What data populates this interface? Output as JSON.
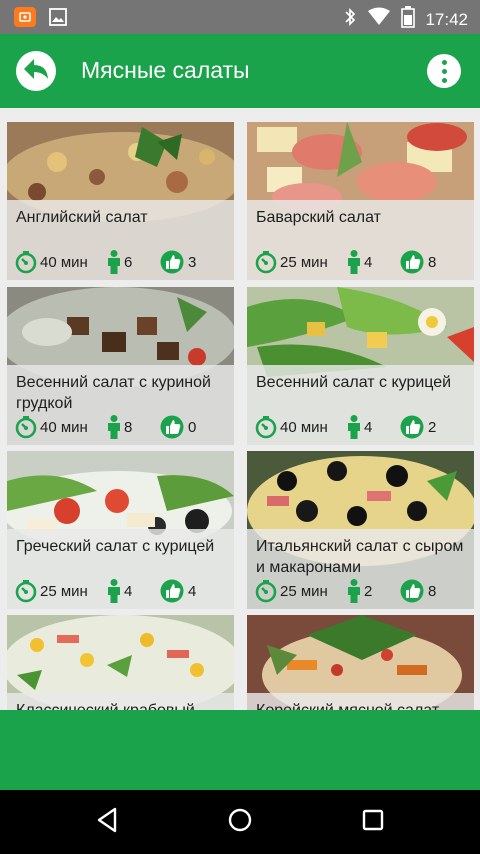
{
  "status_bar": {
    "time": "17:42"
  },
  "header": {
    "title": "Мясные салаты"
  },
  "colors": {
    "accent": "#1aa34a",
    "status_bar": "#757575",
    "nav_bar": "#000000"
  },
  "recipes": [
    {
      "name": "Английский салат",
      "time": "40 мин",
      "persons": "6",
      "likes": "3"
    },
    {
      "name": "Баварский салат",
      "time": "25 мин",
      "persons": "4",
      "likes": "8"
    },
    {
      "name": "Весенний салат с куриной грудкой",
      "time": "40 мин",
      "persons": "8",
      "likes": "0"
    },
    {
      "name": "Весенний салат с курицей",
      "time": "40 мин",
      "persons": "4",
      "likes": "2"
    },
    {
      "name": "Греческий салат с курицей",
      "time": "25 мин",
      "persons": "4",
      "likes": "4"
    },
    {
      "name": "Итальянский салат с сыром и макаронами",
      "time": "25 мин",
      "persons": "2",
      "likes": "8"
    },
    {
      "name": "Классический крабовый",
      "time": "",
      "persons": "",
      "likes": ""
    },
    {
      "name": "Корейский мясной салат",
      "time": "",
      "persons": "",
      "likes": ""
    }
  ],
  "icons": {
    "status_left": [
      "app-notification-icon",
      "image-notification-icon"
    ],
    "status_right": [
      "bluetooth-icon",
      "wifi-icon",
      "battery-icon"
    ],
    "recipe_stats": [
      "timer-icon",
      "person-icon",
      "thumbs-up-icon"
    ],
    "navigation": [
      "back-triangle-icon",
      "home-circle-icon",
      "recents-square-icon"
    ]
  }
}
